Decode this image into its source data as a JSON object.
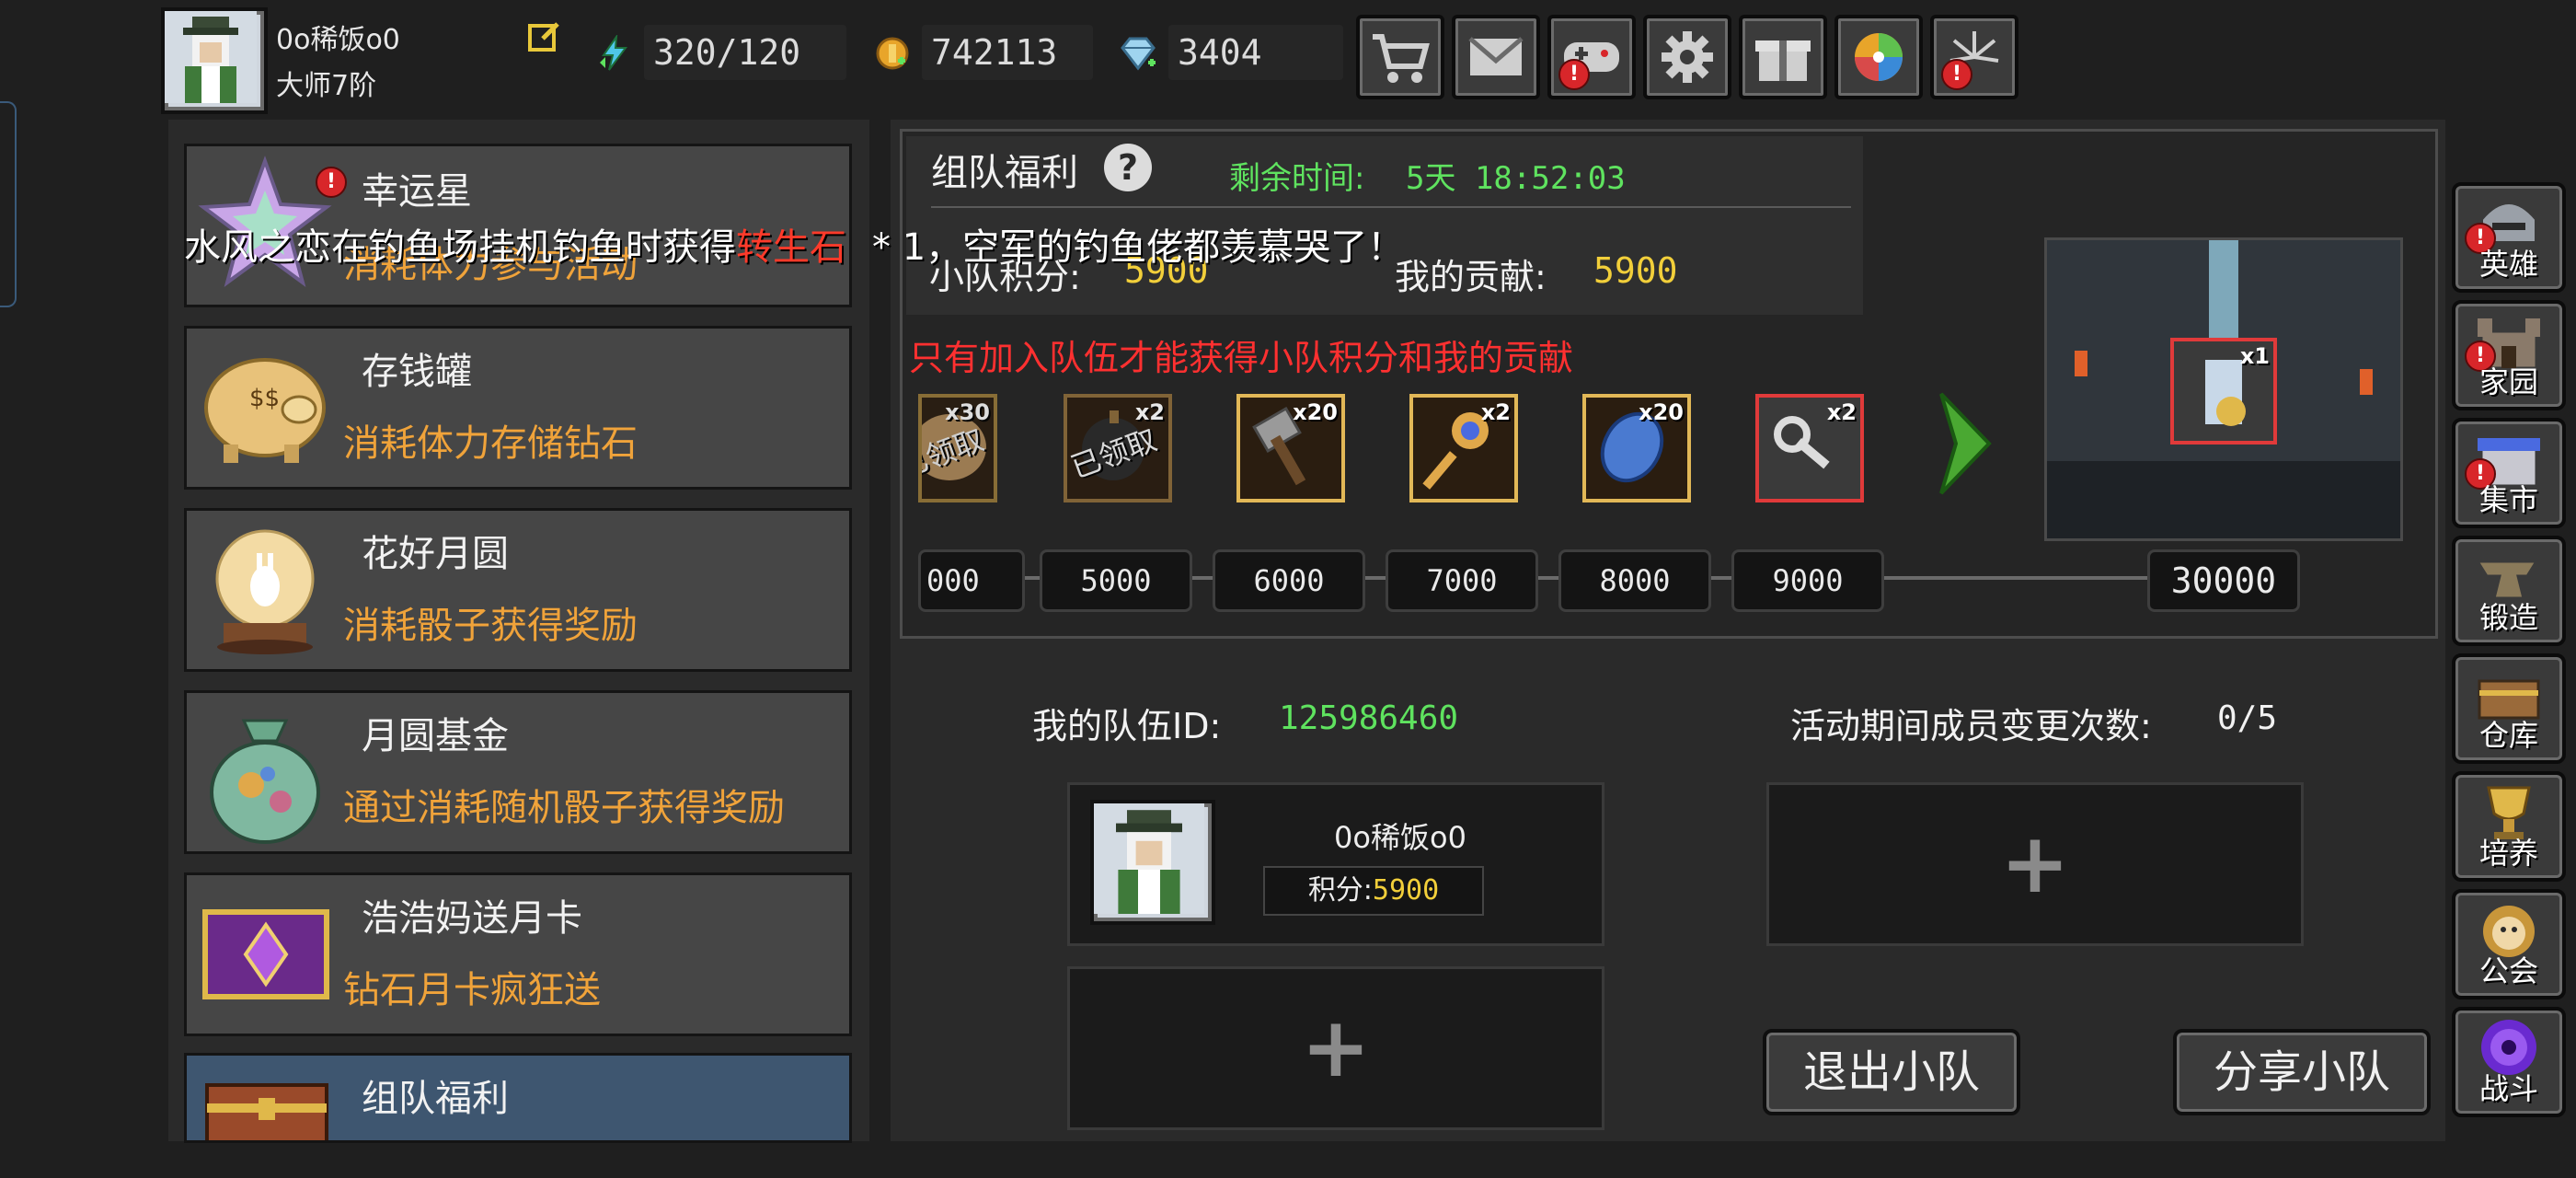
{
  "profile": {
    "name": "0o稀饭o0",
    "rank": "大师7阶"
  },
  "resources": {
    "energy": "320/120",
    "gold": "742113",
    "gems": "3404"
  },
  "top_buttons": [
    {
      "icon": "cart-icon"
    },
    {
      "icon": "mail-icon"
    },
    {
      "icon": "gamepad-icon"
    },
    {
      "icon": "gear-icon"
    },
    {
      "icon": "gift-icon"
    },
    {
      "icon": "color-wheel-icon"
    },
    {
      "icon": "fireworks-icon"
    }
  ],
  "sidebar": {
    "items": [
      {
        "title": "幸运星",
        "subtitle": "消耗体力参与活动"
      },
      {
        "title": "存钱罐",
        "subtitle": "消耗体力存储钻石"
      },
      {
        "title": "花好月圆",
        "subtitle": "消耗骰子获得奖励"
      },
      {
        "title": "月圆基金",
        "subtitle": "通过消耗随机骰子获得奖励"
      },
      {
        "title": "浩浩妈送月卡",
        "subtitle": "钻石月卡疯狂送"
      },
      {
        "title": "组队福利",
        "subtitle": ""
      }
    ]
  },
  "ticker": {
    "prefix": "水风之恋在钓鱼场挂机钓鱼时获得",
    "item": "转生石",
    "suffix": "* 1，空军的钓鱼佬都羡慕哭了！"
  },
  "team_panel": {
    "title": "组队福利",
    "help": "?",
    "remaining_label": "剩余时间:",
    "remaining_value": "5天 18:52:03",
    "team_score_label": "小队积分:",
    "team_score_value": "5900",
    "my_contrib_label": "我的贡献:",
    "my_contrib_value": "5900",
    "warning": "只有加入队伍才能获得小队积分和我的贡献",
    "rewards": [
      {
        "qty": "x30",
        "claimed": "已领取",
        "icon": "stone-icon"
      },
      {
        "qty": "x2",
        "claimed": "已领取",
        "icon": "bomb-icon"
      },
      {
        "qty": "x20",
        "claimed": "",
        "icon": "hammer-icon"
      },
      {
        "qty": "x2",
        "claimed": "",
        "icon": "magic-staff-icon"
      },
      {
        "qty": "x20",
        "claimed": "",
        "icon": "sapphire-icon"
      },
      {
        "qty": "x2",
        "claimed": "",
        "icon": "key-icon"
      }
    ],
    "milestones": [
      "000",
      "5000",
      "6000",
      "7000",
      "8000",
      "9000"
    ],
    "final_milestone": "30000",
    "final_reward_qty": "x1"
  },
  "team": {
    "id_label": "我的队伍ID:",
    "id_value": "125986460",
    "changes_label": "活动期间成员变更次数:",
    "changes_value": "0/5",
    "member": {
      "name": "0o稀饭o0",
      "score_label": "积分:",
      "score_value": "5900"
    },
    "plus": "+",
    "leave_button": "退出小队",
    "share_button": "分享小队"
  },
  "right_nav": [
    {
      "label": "英雄",
      "icon": "helmet-icon",
      "alert": true
    },
    {
      "label": "家园",
      "icon": "castle-icon",
      "alert": true
    },
    {
      "label": "集市",
      "icon": "market-icon",
      "alert": true
    },
    {
      "label": "锻造",
      "icon": "anvil-icon",
      "alert": false
    },
    {
      "label": "仓库",
      "icon": "chest-icon",
      "alert": false
    },
    {
      "label": "培养",
      "icon": "trophy-icon",
      "alert": false
    },
    {
      "label": "公会",
      "icon": "lion-icon",
      "alert": false
    },
    {
      "label": "战斗",
      "icon": "portal-icon",
      "alert": false
    }
  ],
  "colors": {
    "accent_green": "#5fe35f",
    "accent_yellow": "#f2cf3a",
    "accent_orange": "#f0a33a",
    "warning_red": "#ff3030"
  }
}
